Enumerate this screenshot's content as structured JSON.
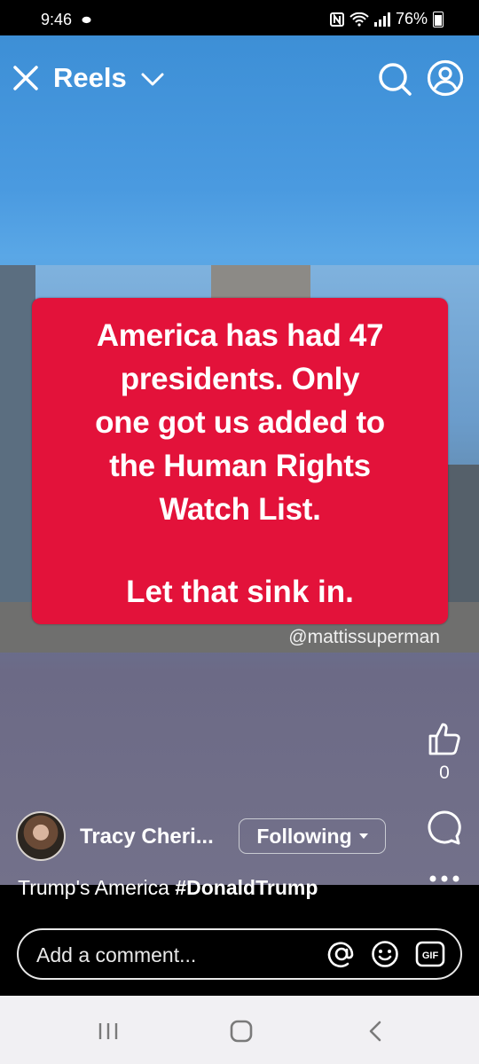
{
  "status_bar": {
    "time": "9:46",
    "battery": "76%"
  },
  "header": {
    "title": "Reels"
  },
  "video": {
    "card_lines": [
      "America has had 47",
      "presidents. Only",
      "one got us added to",
      "the Human Rights",
      "Watch List."
    ],
    "card_footer": "Let that sink in.",
    "watermark": "@mattissuperman",
    "card_color": "#e3123a"
  },
  "actions": {
    "like_count": "0"
  },
  "author": {
    "name": "Tracy Cheri...",
    "follow_label": "Following"
  },
  "caption": {
    "text": "Trump's America ",
    "hashtag": "#DonaldTrump"
  },
  "comment_input": {
    "placeholder": "Add a comment..."
  },
  "icons": [
    "close-icon",
    "chevron-down-icon",
    "search-icon",
    "profile-icon",
    "like-icon",
    "comment-icon",
    "more-icon",
    "mention-icon",
    "emoji-icon",
    "gif-icon"
  ]
}
